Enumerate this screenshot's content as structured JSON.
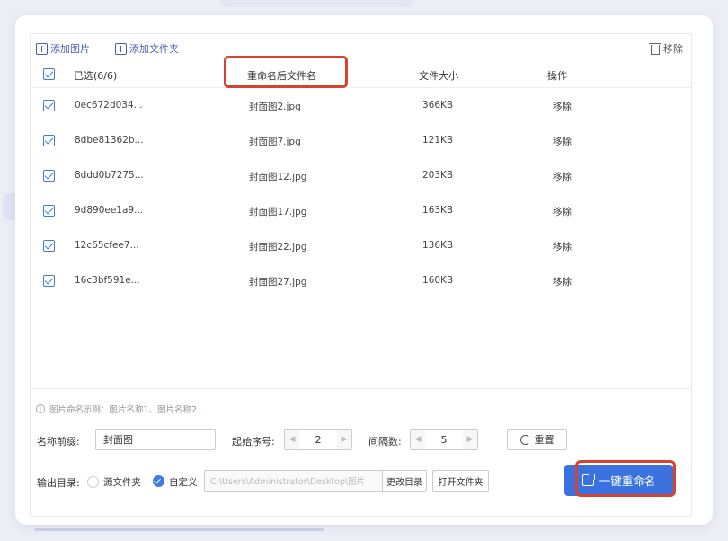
{
  "toolbar": {
    "add_image": "添加图片",
    "add_folder": "添加文件夹",
    "remove": "移除"
  },
  "table": {
    "headers": {
      "selected": "已选(6/6)",
      "renamed": "重命名后文件名",
      "size": "文件大小",
      "action": "操作"
    },
    "rows": [
      {
        "original": "0ec672d034...",
        "renamed": "封面图2.jpg",
        "size": "366KB",
        "action": "移除"
      },
      {
        "original": "8dbe81362b...",
        "renamed": "封面图7.jpg",
        "size": "121KB",
        "action": "移除"
      },
      {
        "original": "8ddd0b7275...",
        "renamed": "封面图12.jpg",
        "size": "203KB",
        "action": "移除"
      },
      {
        "original": "9d890ee1a9...",
        "renamed": "封面图17.jpg",
        "size": "163KB",
        "action": "移除"
      },
      {
        "original": "12c65cfee7...",
        "renamed": "封面图22.jpg",
        "size": "136KB",
        "action": "移除"
      },
      {
        "original": "16c3bf591e...",
        "renamed": "封面图27.jpg",
        "size": "160KB",
        "action": "移除"
      }
    ]
  },
  "hint": "图片命名示例：图片名称1、图片名称2...",
  "settings": {
    "prefix_label": "名称前缀:",
    "prefix_value": "封面图",
    "start_label": "起始序号:",
    "start_value": "2",
    "interval_label": "间隔数:",
    "interval_value": "5",
    "reset": "重置"
  },
  "output": {
    "label": "输出目录:",
    "option_source": "源文件夹",
    "option_custom": "自定义",
    "path": "C:\\Users\\Administrator\\Desktop\\图片",
    "change_dir": "更改目录",
    "open_folder": "打开文件夹"
  },
  "primary_action": "一键重命名",
  "colors": {
    "accent": "#3a72e0",
    "highlight": "#d6432f",
    "link": "#4a5fb0"
  }
}
